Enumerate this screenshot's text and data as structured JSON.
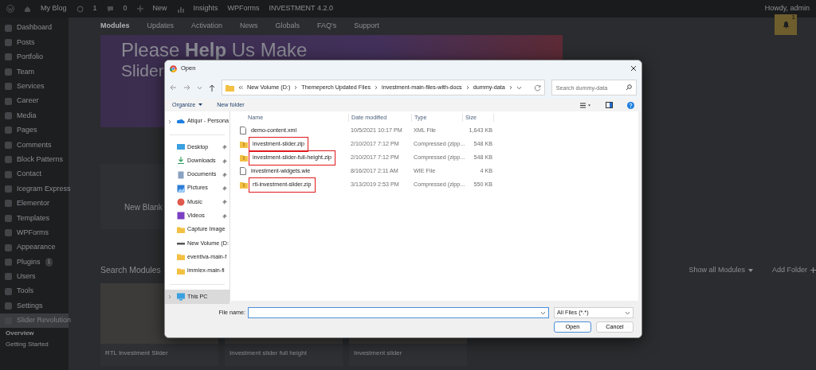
{
  "admin_bar": {
    "site": "My Blog",
    "updates": "1",
    "comments": "0",
    "new": "New",
    "insights": "Insights",
    "wpforms": "WPForms",
    "version": "INVESTMENT 4.2.0",
    "greeting": "Howdy, admin"
  },
  "sidebar": {
    "items": [
      {
        "label": "Dashboard",
        "selected": false
      },
      {
        "label": "Posts",
        "selected": false
      },
      {
        "label": "Portfolio",
        "selected": false
      },
      {
        "label": "Team",
        "selected": false
      },
      {
        "label": "Services",
        "selected": false
      },
      {
        "label": "Career",
        "selected": false
      },
      {
        "label": "Media",
        "selected": false
      },
      {
        "label": "Pages",
        "selected": false
      },
      {
        "label": "Comments",
        "selected": false
      },
      {
        "label": "Block Patterns",
        "selected": false
      },
      {
        "label": "Contact",
        "selected": false
      },
      {
        "label": "Icegram Express",
        "selected": false
      },
      {
        "label": "Elementor",
        "selected": false
      },
      {
        "label": "Templates",
        "selected": false
      },
      {
        "label": "WPForms",
        "selected": false
      },
      {
        "label": "Appearance",
        "selected": false
      },
      {
        "label": "Plugins",
        "badge": "1",
        "selected": false
      },
      {
        "label": "Users",
        "selected": false
      },
      {
        "label": "Tools",
        "selected": false
      },
      {
        "label": "Settings",
        "selected": false
      },
      {
        "label": "Slider Revolution",
        "selected": true
      }
    ],
    "submenu": [
      {
        "label": "Overview",
        "selected": true
      },
      {
        "label": "Getting Started",
        "selected": false
      }
    ]
  },
  "tabs": [
    {
      "label": "Modules",
      "selected": true
    },
    {
      "label": "Updates",
      "selected": false
    },
    {
      "label": "Activation",
      "selected": false
    },
    {
      "label": "News",
      "selected": false
    },
    {
      "label": "Globals",
      "selected": false
    },
    {
      "label": "FAQ's",
      "selected": false
    },
    {
      "label": "Support",
      "selected": false
    }
  ],
  "notification_count": "1",
  "banner": {
    "line_1": "Please **Help** Us Make",
    "line_2": "Slider"
  },
  "new_blank": "New Blank",
  "search_modules": "Search Modules",
  "show_all": "Show all Modules",
  "add_folder": "Add Folder",
  "modules": [
    {
      "title": "RTL Investment Slider"
    },
    {
      "title": "Investment slider full height"
    },
    {
      "title": "Investment slider"
    }
  ],
  "dialog": {
    "title": "Open",
    "path": [
      "New Volume (D:)",
      "Themeperch Updated Files",
      "investment-main-files-with-docs",
      "dummy-data"
    ],
    "search_placeholder": "Search dummy-data",
    "organize": "Organize",
    "new_folder": "New folder",
    "nav": [
      {
        "label": "Atiqur - Persona",
        "kind": "cloud",
        "pinned": false,
        "expandable": true,
        "selected": false
      },
      {
        "label": "Desktop",
        "kind": "desktop",
        "pinned": true,
        "expandable": false,
        "selected": false
      },
      {
        "label": "Downloads",
        "kind": "download",
        "pinned": true,
        "expandable": false,
        "selected": false
      },
      {
        "label": "Documents",
        "kind": "document",
        "pinned": true,
        "expandable": false,
        "selected": false
      },
      {
        "label": "Pictures",
        "kind": "picture",
        "pinned": true,
        "expandable": false,
        "selected": false
      },
      {
        "label": "Music",
        "kind": "music",
        "pinned": true,
        "expandable": false,
        "selected": false
      },
      {
        "label": "Videos",
        "kind": "video",
        "pinned": true,
        "expandable": false,
        "selected": false
      },
      {
        "label": "Capture Image",
        "kind": "folder",
        "pinned": false,
        "expandable": false,
        "selected": false
      },
      {
        "label": "New Volume (D:",
        "kind": "drive",
        "pinned": false,
        "expandable": false,
        "selected": false
      },
      {
        "label": "eventiva-main-f",
        "kind": "folder",
        "pinned": false,
        "expandable": false,
        "selected": false
      },
      {
        "label": "immiex-main-fi",
        "kind": "folder",
        "pinned": false,
        "expandable": false,
        "selected": false
      },
      {
        "label": "This PC",
        "kind": "pc",
        "pinned": false,
        "expandable": true,
        "selected": true
      }
    ],
    "columns": [
      "Name",
      "Date modified",
      "Type",
      "Size"
    ],
    "files": [
      {
        "name": "demo-content.xml",
        "kind": "document",
        "date": "10/5/2021 10:17 PM",
        "type": "XML File",
        "size": "1,643 KB",
        "highlighted": false
      },
      {
        "name": "investment-slider.zip",
        "kind": "zip",
        "date": "2/10/2017 7:12 PM",
        "type": "Compressed (zipp...",
        "size": "548 KB",
        "highlighted": true
      },
      {
        "name": "investment-slider-full-height.zip",
        "kind": "zip",
        "date": "2/10/2017 7:12 PM",
        "type": "Compressed (zipp...",
        "size": "548 KB",
        "highlighted": true
      },
      {
        "name": "investment-widgets.wie",
        "kind": "document",
        "date": "8/16/2017 2:11 AM",
        "type": "WIE File",
        "size": "4 KB",
        "highlighted": false
      },
      {
        "name": "rtl-investment-slider.zip",
        "kind": "zip",
        "date": "3/13/2019 2:53 PM",
        "type": "Compressed (zipp...",
        "size": "550 KB",
        "highlighted": true
      }
    ],
    "file_name_label": "File name:",
    "file_type": "All Files (*.*)",
    "open": "Open",
    "cancel": "Cancel"
  }
}
